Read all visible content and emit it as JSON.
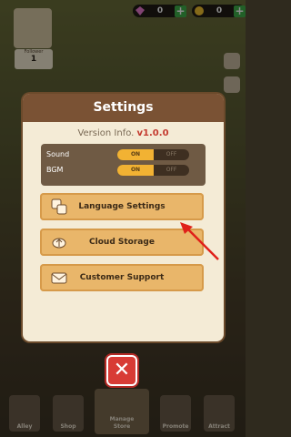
{
  "top_bar": {
    "gems": "0",
    "coins": "0",
    "plus_label": "+"
  },
  "follower": {
    "label": "Follower",
    "count": "1"
  },
  "dialog": {
    "title": "Settings",
    "version_label": "Version Info.",
    "version_value": "v1.0.0",
    "rows": [
      {
        "name": "Sound",
        "on": "ON",
        "off": "OFF"
      },
      {
        "name": "BGM",
        "on": "ON",
        "off": "OFF"
      }
    ],
    "buttons": [
      {
        "label": "Language Settings"
      },
      {
        "label": "Cloud Storage"
      },
      {
        "label": "Customer Support"
      }
    ]
  },
  "close_label": "✕",
  "nav": {
    "items": [
      {
        "label": "Alley"
      },
      {
        "label": "Shop"
      },
      {
        "label": "Manage\nStore"
      },
      {
        "label": "Promote"
      },
      {
        "label": "Attract"
      }
    ]
  },
  "colors": {
    "accent": "#f2b233",
    "header": "#7a5234",
    "close": "#d83b35",
    "arrow": "#e0201a"
  }
}
